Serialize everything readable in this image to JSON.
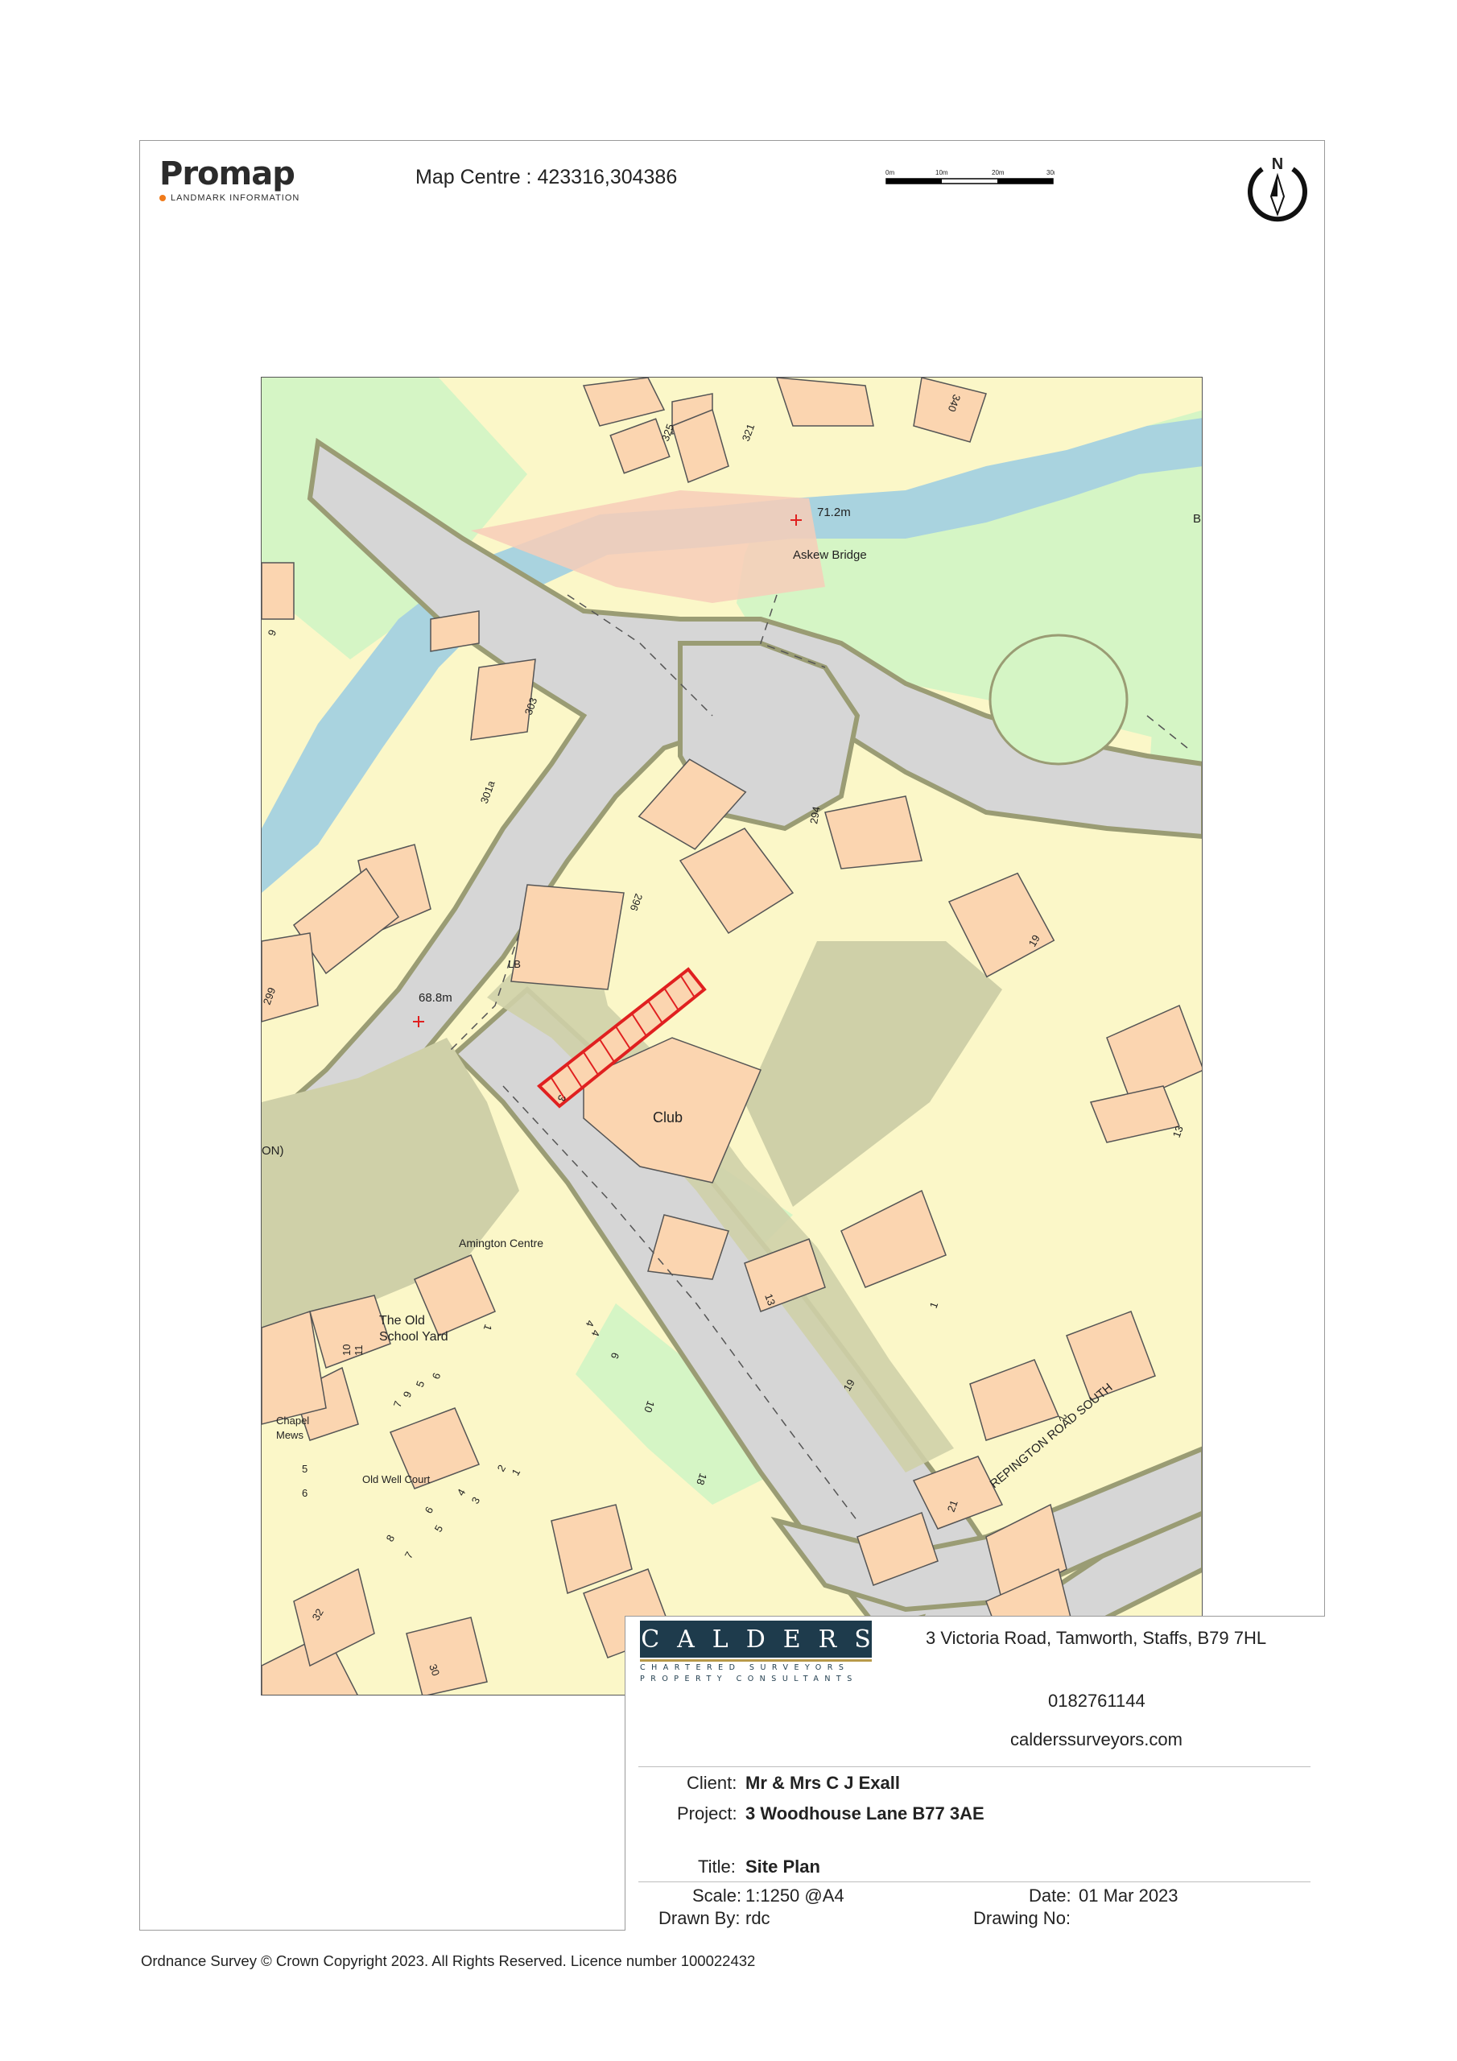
{
  "header": {
    "logo_word": "Promap",
    "logo_sub": "LANDMARK INFORMATION",
    "map_centre": "Map Centre : 423316,304386",
    "scale_ticks": [
      "0m",
      "10m",
      "20m",
      "30m"
    ],
    "north_letter": "N"
  },
  "map": {
    "labels": {
      "spot_height_1": "71.2m",
      "spot_height_2": "68.8m",
      "bridge": "Askew Bridge",
      "club": "Club",
      "amington_centre": "Amington Centre",
      "old_school_yard_1": "The Old",
      "old_school_yard_2": "School Yard",
      "chapel_mews_1": "Chapel",
      "chapel_mews_2": "Mews",
      "old_well_court": "Old Well Court",
      "repington_road_south": "REPINGTON ROAD SOUTH",
      "lb": "LB",
      "on_fragment": "ON)",
      "b_fragment": "B"
    },
    "house_numbers": {
      "n325": "325",
      "n321": "321",
      "n340": "340",
      "n303": "303",
      "n301a": "301a",
      "n294": "294",
      "n296": "296",
      "n19a": "19",
      "n299": "299",
      "n3": "3",
      "n13a": "13",
      "n13b": "13",
      "n1a": "1",
      "n19b": "19",
      "n2a": "2",
      "n21": "21",
      "n6a": "6",
      "n10": "10",
      "n11": "11",
      "n4a": "4",
      "n1b": "1",
      "n5a": "5",
      "n6b": "6",
      "n9a": "9",
      "n7a": "7",
      "n4b": "4",
      "n6c": "6",
      "n10b": "10",
      "n18": "18",
      "n5b": "5",
      "n6d": "6",
      "n2b": "2",
      "n1c": "1",
      "n3b": "3",
      "n4c": "4",
      "n5c": "5",
      "n6e": "6",
      "n7b": "7",
      "n8": "8",
      "n32": "32",
      "n30": "30"
    },
    "colors": {
      "building": "#fbd5b0",
      "land": "#fbf7c8",
      "grass": "#d5f5c5",
      "road": "#d6d6d6",
      "verge": "#cfd0a8",
      "river": "#a9d3df",
      "bridge": "#f7cdb9",
      "site_outline": "#e02020"
    }
  },
  "title_block": {
    "address": "3 Victoria Road, Tamworth, Staffs, B79 7HL",
    "phone": "0182761144",
    "website": "calderssurveyors.com",
    "company": "CALDERS",
    "company_sub_1": "CHARTERED SURVEYORS",
    "company_sub_2": "PROPERTY CONSULTANTS",
    "client_label": "Client:",
    "client_value": "Mr & Mrs C J Exall",
    "project_label": "Project:",
    "project_value": "3 Woodhouse Lane B77 3AE",
    "title_label": "Title:",
    "title_value": "Site Plan",
    "scale_label": "Scale:",
    "scale_value": "1:1250 @A4",
    "date_label": "Date:",
    "date_value": "01 Mar 2023",
    "drawn_label": "Drawn By:",
    "drawn_value": "rdc",
    "drawing_no_label": "Drawing No:"
  },
  "footer": {
    "copyright": "Ordnance Survey © Crown Copyright 2023. All Rights Reserved. Licence number 100022432"
  }
}
